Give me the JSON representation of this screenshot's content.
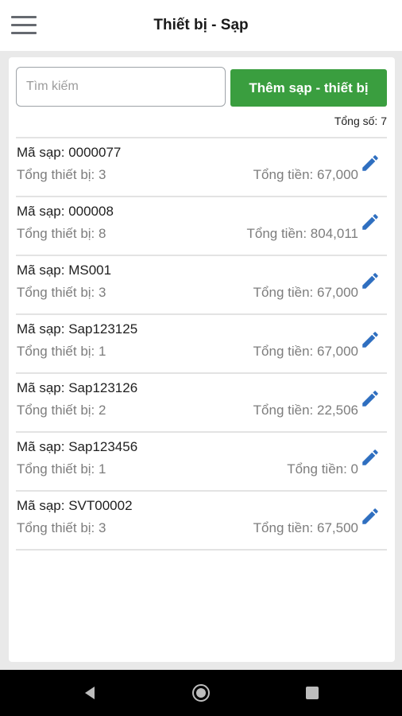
{
  "header": {
    "title": "Thiết bị - Sạp",
    "menu_icon": "hamburger-menu-icon"
  },
  "search": {
    "placeholder": "Tìm kiếm",
    "value": ""
  },
  "add_button": {
    "label": "Thêm sạp - thiết bị",
    "color": "#3a9e3f"
  },
  "total_label": "Tổng số: 7",
  "items": [
    {
      "code": "Mã sạp: 0000077",
      "count": "Tổng thiết bị: 3",
      "amount": "Tổng tiền: 67,000"
    },
    {
      "code": "Mã sạp: 000008",
      "count": "Tổng thiết bị: 8",
      "amount": "Tổng tiền: 804,011"
    },
    {
      "code": "Mã sạp: MS001",
      "count": "Tổng thiết bị: 3",
      "amount": "Tổng tiền: 67,000"
    },
    {
      "code": "Mã sạp: Sap123125",
      "count": "Tổng thiết bị: 1",
      "amount": "Tổng tiền: 67,000"
    },
    {
      "code": "Mã sạp: Sap123126",
      "count": "Tổng thiết bị: 2",
      "amount": "Tổng tiền: 22,506"
    },
    {
      "code": "Mã sạp: Sap123456",
      "count": "Tổng thiết bị: 1",
      "amount": "Tổng tiền: 0"
    },
    {
      "code": "Mã sạp: SVT00002",
      "count": "Tổng thiết bị: 3",
      "amount": "Tổng tiền: 67,500"
    }
  ],
  "edit_icon": "pencil-icon",
  "colors": {
    "accent_blue": "#2f6fc0",
    "button_green": "#3a9e3f"
  },
  "navbar": {
    "back_icon": "back-triangle-icon",
    "home_icon": "home-circle-icon",
    "recent_icon": "recent-apps-square-icon"
  }
}
